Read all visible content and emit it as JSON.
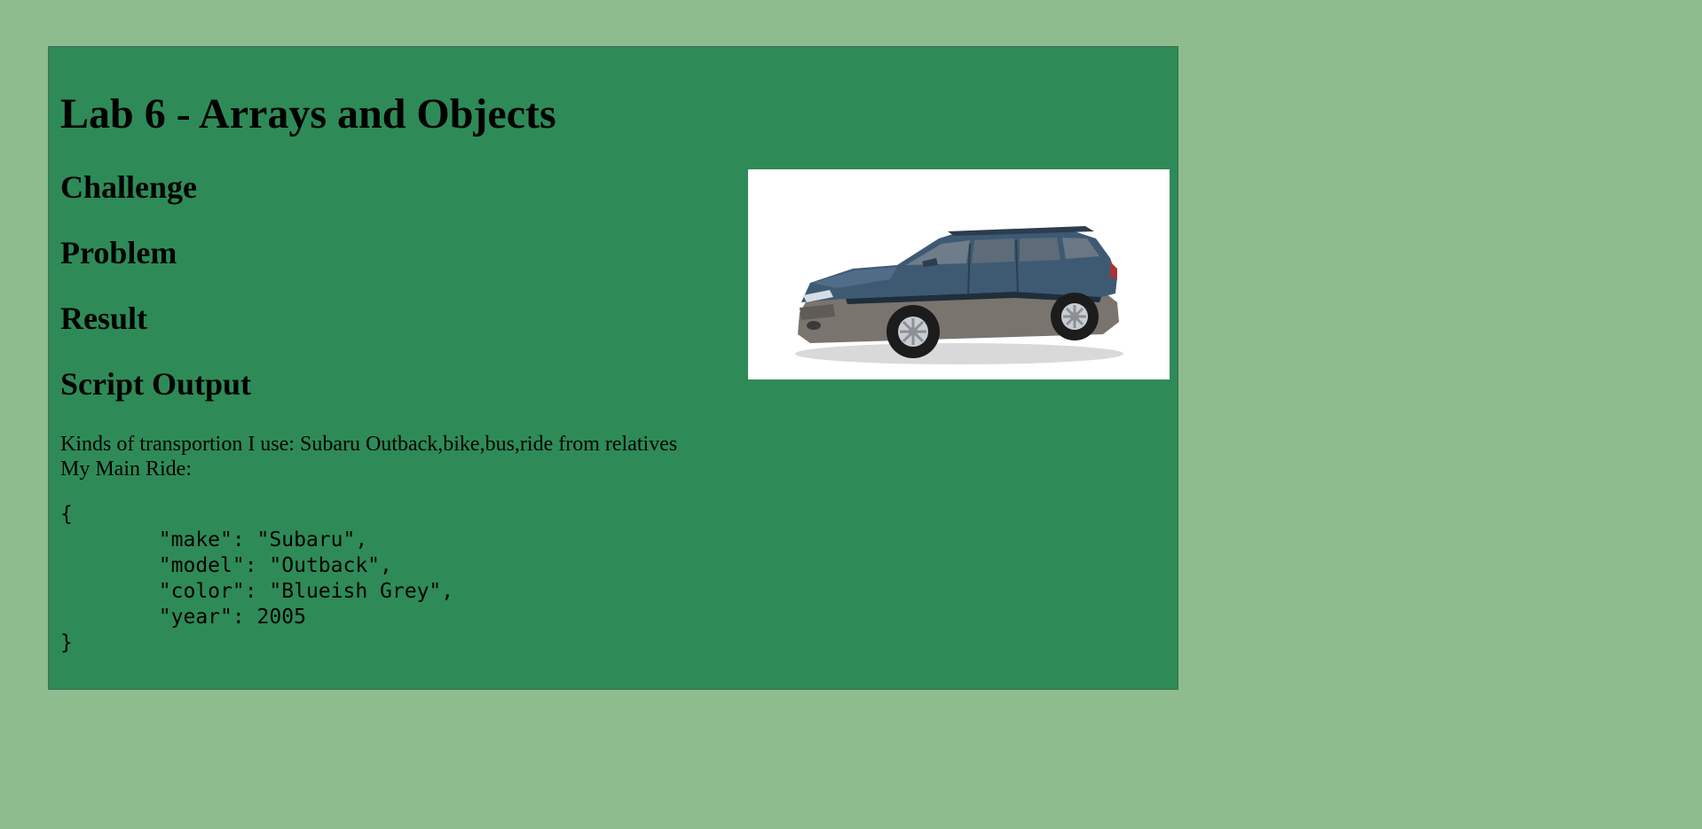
{
  "page": {
    "title": "Lab 6 - Arrays and Objects",
    "sections": {
      "challenge": "Challenge",
      "problem": "Problem",
      "result": "Result",
      "script_output": "Script Output"
    },
    "output": {
      "transport_line": "Kinds of transportion I use: Subaru Outback,bike,bus,ride from relatives",
      "main_ride_line": "My Main Ride:",
      "json_text": "{\n\t\"make\": \"Subaru\",\n\t\"model\": \"Outback\",\n\t\"color\": \"Blueish Grey\",\n\t\"year\": 2005\n}"
    },
    "image": {
      "subject": "car-image",
      "body_color": "#3e5a73",
      "cladding_color": "#7a746f"
    }
  },
  "colors": {
    "page_background": "#8fbc8f",
    "panel_background": "#2e8b57",
    "image_background": "#ffffff"
  }
}
